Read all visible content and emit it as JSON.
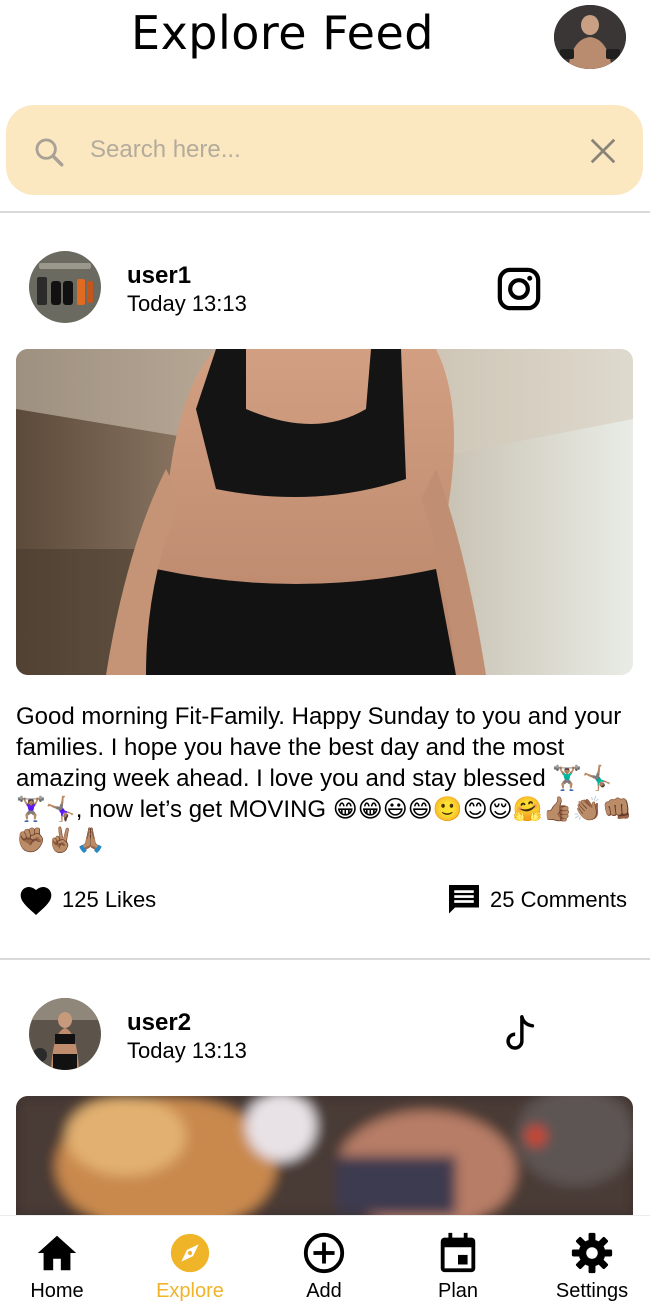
{
  "header": {
    "title": "Explore Feed",
    "avatar_icon": "profile-avatar"
  },
  "search": {
    "placeholder": "Search here...",
    "value": "",
    "icon": "search-icon",
    "clear_icon": "close-icon"
  },
  "posts": [
    {
      "user": "user1",
      "time": "Today 13:13",
      "platform": "instagram",
      "caption": "Good morning Fit-Family. Happy Sunday to you and your families. I hope you have the best day and the most amazing week ahead. I love you and stay blessed 🏋🏽‍♂️🤸🏽‍♂️🏋🏽‍♀️🤸🏽‍♀️, now let’s get MOVING 😁😁😃😄🙂😊😌🤗👍🏽👏🏽👊🏽✊🏽✌🏽🙏🏽",
      "likes": "125 Likes",
      "comments": "25 Comments"
    },
    {
      "user": "user2",
      "time": "Today 13:13",
      "platform": "tiktok"
    }
  ],
  "nav": {
    "items": [
      {
        "label": "Home",
        "icon": "home-icon",
        "active": false
      },
      {
        "label": "Explore",
        "icon": "compass-icon",
        "active": true
      },
      {
        "label": "Add",
        "icon": "add-circle-icon",
        "active": false
      },
      {
        "label": "Plan",
        "icon": "calendar-icon",
        "active": false
      },
      {
        "label": "Settings",
        "icon": "gear-icon",
        "active": false
      }
    ],
    "active_color": "#f0b429",
    "inactive_color": "#000000"
  },
  "colors": {
    "search_bg": "#fbe8c1",
    "accent": "#f0b429",
    "divider": "#d9d9d9"
  }
}
